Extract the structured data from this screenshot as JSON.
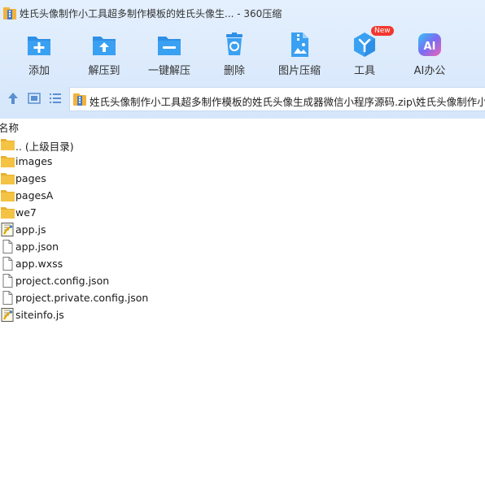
{
  "window": {
    "title": "姓氏头像制作小工具超多制作模板的姓氏头像生...  - 360压缩"
  },
  "toolbar": {
    "items": [
      {
        "label": "添加",
        "icon": "add-folder-icon"
      },
      {
        "label": "解压到",
        "icon": "extract-to-icon"
      },
      {
        "label": "一键解压",
        "icon": "one-click-extract-icon"
      },
      {
        "label": "删除",
        "icon": "delete-icon"
      },
      {
        "label": "图片压缩",
        "icon": "image-compress-icon"
      },
      {
        "label": "工具",
        "icon": "tools-icon",
        "badge": "New"
      },
      {
        "label": "AI办公",
        "icon": "ai-office-icon"
      }
    ]
  },
  "navigation": {
    "path": "姓氏头像制作小工具超多制作模板的姓氏头像生成器微信小程序源码.zip\\姓氏头像制作小工具"
  },
  "file_list": {
    "column_name": "名称",
    "items": [
      {
        "name": ".. (上级目录)",
        "type": "folder"
      },
      {
        "name": "images",
        "type": "folder"
      },
      {
        "name": "pages",
        "type": "folder"
      },
      {
        "name": "pagesA",
        "type": "folder"
      },
      {
        "name": "we7",
        "type": "folder"
      },
      {
        "name": "app.js",
        "type": "script"
      },
      {
        "name": "app.json",
        "type": "file"
      },
      {
        "name": "app.wxss",
        "type": "file"
      },
      {
        "name": "project.config.json",
        "type": "file"
      },
      {
        "name": "project.private.config.json",
        "type": "file"
      },
      {
        "name": "siteinfo.js",
        "type": "script"
      }
    ]
  },
  "colors": {
    "chrome_bg": "#dbeafc",
    "icon_blue": "#2e8fe6",
    "folder_yellow": "#f5c343",
    "badge_red": "#f2372e"
  }
}
